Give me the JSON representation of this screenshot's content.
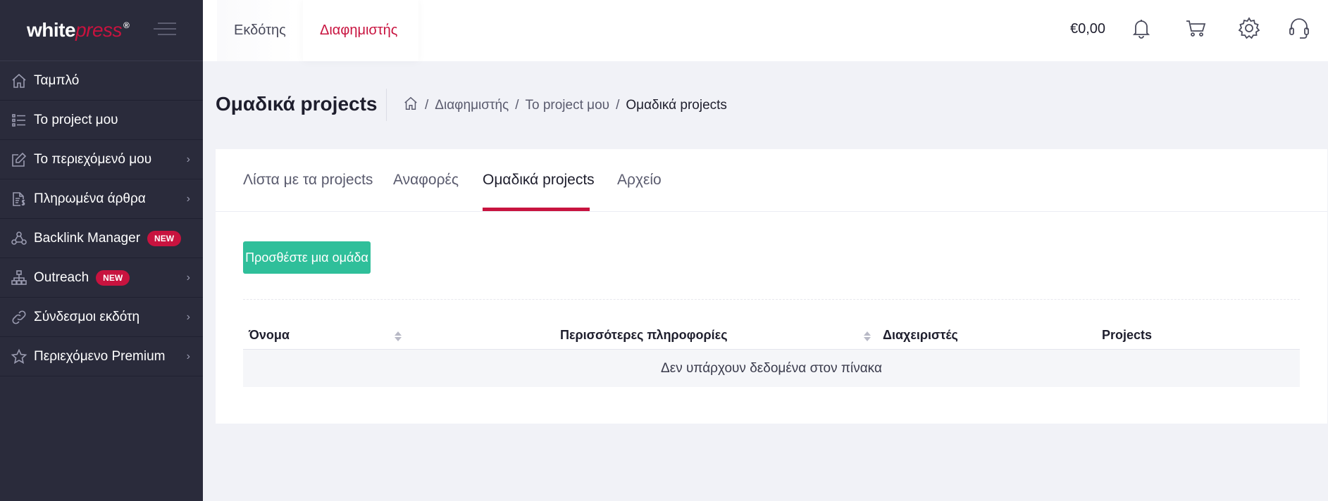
{
  "logo": {
    "white": "white",
    "press": "press",
    "reg": "®"
  },
  "sidebar": {
    "items": [
      {
        "label": "Ταμπλό",
        "icon": "home-icon"
      },
      {
        "label": "Το project μου",
        "icon": "list-icon"
      },
      {
        "label": "Το περιεχόμενό μου",
        "icon": "edit-icon"
      },
      {
        "label": "Πληρωμένα άρθρα",
        "icon": "paid-document-icon"
      },
      {
        "label": "Backlink Manager",
        "icon": "network-icon",
        "badge": "NEW"
      },
      {
        "label": "Outreach",
        "icon": "sitemap-icon",
        "badge": "NEW"
      },
      {
        "label": "Σύνδεσμοι εκδότη",
        "icon": "link-icon"
      },
      {
        "label": "Περιεχόμενο Premium",
        "icon": "star-icon"
      }
    ]
  },
  "topbar": {
    "tabs": [
      {
        "label": "Εκδότης"
      },
      {
        "label": "Διαφημιστής",
        "active": true
      }
    ],
    "balance": "€0,00",
    "icons": [
      "bell-icon",
      "cart-icon",
      "gear-icon",
      "headset-icon"
    ]
  },
  "page": {
    "title": "Ομαδικά projects",
    "breadcrumb": [
      "Διαφημιστής",
      "Το project μου",
      "Ομαδικά projects"
    ]
  },
  "tabs": [
    {
      "label": "Λίστα με τα projects"
    },
    {
      "label": "Αναφορές"
    },
    {
      "label": "Ομαδικά projects",
      "active": true
    },
    {
      "label": "Αρχείο"
    }
  ],
  "add_button": "Προσθέστε μια ομάδα",
  "table": {
    "columns": [
      "Όνομα",
      "Περισσότερες πληροφορίες",
      "Διαχειριστές",
      "Projects"
    ],
    "empty_message": "Δεν υπάρχουν δεδομένα στον πίνακα"
  },
  "colors": {
    "accent": "#c8133f",
    "button": "#2fbf9a",
    "sidebar": "#2a2b3b"
  }
}
